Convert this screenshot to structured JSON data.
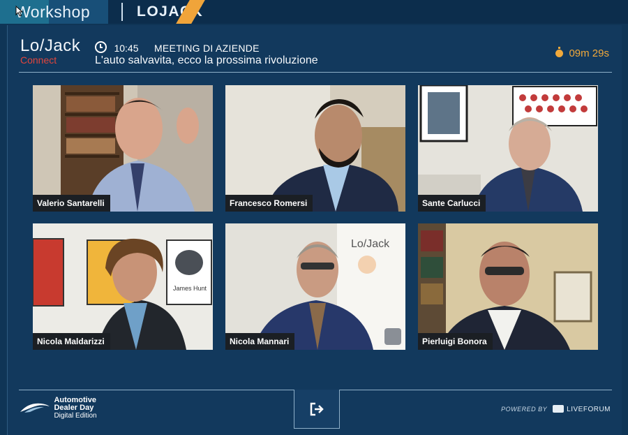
{
  "topbar": {
    "workshop": "Workshop",
    "brand": "LOJACK"
  },
  "header": {
    "logo": "Lo/Jack",
    "logo_sub": "Connect",
    "time": "10:45",
    "meeting_type": "MEETING DI AZIENDE",
    "meeting_title": "L'auto salvavita, ecco la prossima rivoluzione",
    "timer": "09m 29s"
  },
  "participants": [
    {
      "name": "Valerio Santarelli"
    },
    {
      "name": "Francesco Romersi"
    },
    {
      "name": "Sante Carlucci"
    },
    {
      "name": "Nicola Maldarizzi"
    },
    {
      "name": "Nicola Mannari"
    },
    {
      "name": "Pierluigi Bonora"
    }
  ],
  "video_texts": {
    "poster_text": "James Hunt",
    "banner_logo": "Lo/Jack"
  },
  "footer": {
    "event_line1": "Automotive",
    "event_line2": "Dealer Day",
    "event_line3": "Digital Edition",
    "powered_by": "POWERED BY",
    "platform": "LIVEFORUM"
  },
  "colors": {
    "accent": "#f1a93b",
    "brand_red": "#e2453c",
    "panel": "#12395d"
  }
}
